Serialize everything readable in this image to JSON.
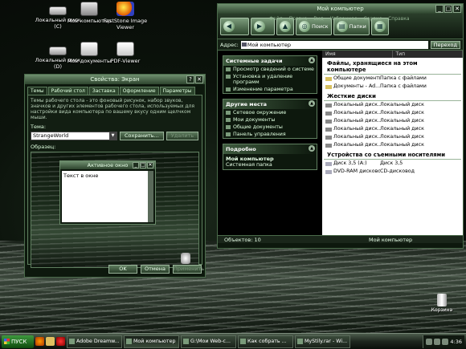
{
  "desktop": {
    "icons": [
      {
        "label": "Локальный диск (C)",
        "icon": "drive-icon"
      },
      {
        "label": "Мой компьютер",
        "icon": "computer-icon"
      },
      {
        "label": "FastStone Image Viewer",
        "icon": "faststone-icon"
      },
      {
        "label": "Локальный диск (D)",
        "icon": "drive-icon"
      },
      {
        "label": "Мои документы",
        "icon": "documents-icon"
      },
      {
        "label": "PDF-Viewer",
        "icon": "pdf-icon"
      }
    ],
    "recycle_label": "Корзина"
  },
  "props": {
    "title": "Свойства: Экран",
    "tabs": [
      "Темы",
      "Рабочий стол",
      "Заставка",
      "Оформление",
      "Параметры"
    ],
    "description": "Темы рабочего стола - это фоновый рисунок, набор звуков, значков и других элементов рабочего стола, используемых для настройки вида компьютера по вашему вкусу одним щелчком мыши.",
    "theme_label": "Тема:",
    "theme_value": "StrangeWorld",
    "save_label": "Сохранить...",
    "delete_label": "Удалить",
    "preview_label": "Образец:",
    "preview_window_title": "Активное окно",
    "preview_window_text": "Текст в окне",
    "ok_label": "OK",
    "cancel_label": "Отмена",
    "apply_label": "Применить"
  },
  "explorer": {
    "title": "Мой компьютер",
    "menus": [
      "Файл",
      "Правка",
      "Вид",
      "Избранное",
      "Сервис",
      "Справка"
    ],
    "search_label": "Поиск",
    "folders_label": "Папки",
    "address_label": "Адрес:",
    "address_value": "Мой компьютер",
    "go_label": "Переход",
    "tasks": {
      "system_title": "Системные задачи",
      "system_items": [
        "Просмотр сведений о системе",
        "Установка и удаление программ",
        "Изменение параметра"
      ],
      "places_title": "Другие места",
      "places_items": [
        "Сетевое окружение",
        "Мои документы",
        "Общие документы",
        "Панель управления"
      ],
      "details_title": "Подробно",
      "details_name": "Мой компьютер",
      "details_type": "Системная папка"
    },
    "columns": [
      "Имя",
      "Тип"
    ],
    "groups": {
      "files_title": "Файлы, хранящиеся на этом компьютере",
      "files": [
        {
          "name": "Общие документы",
          "type": "Папка с файлами"
        },
        {
          "name": "Документы - Ad...",
          "type": "Папка с файлами"
        }
      ],
      "drives_title": "Жесткие диски",
      "drives": [
        {
          "name": "Локальный диск...",
          "type": "Локальный диск"
        },
        {
          "name": "Локальный диск...",
          "type": "Локальный диск"
        },
        {
          "name": "Локальный диск...",
          "type": "Локальный диск"
        },
        {
          "name": "Локальный диск...",
          "type": "Локальный диск"
        },
        {
          "name": "Локальный диск...",
          "type": "Локальный диск"
        },
        {
          "name": "Локальный диск...",
          "type": "Локальный диск"
        }
      ],
      "removable_title": "Устройства со съемными носителями",
      "removable": [
        {
          "name": "Диск 3,5 (A:)",
          "type": "Диск 3,5"
        },
        {
          "name": "DVD-RAM дисково...",
          "type": "CD-дисковод"
        }
      ]
    },
    "status_objects": "Объектов: 10",
    "status_location": "Мой компьютер"
  },
  "taskbar": {
    "start_label": "ПУСК",
    "tasks": [
      "Adobe Dreamw...",
      "Мой компьютер",
      "G:\\Мои Web-с...",
      "Как собрать ...",
      "MyStily.rar - Wi..."
    ],
    "clock": "4:36"
  }
}
